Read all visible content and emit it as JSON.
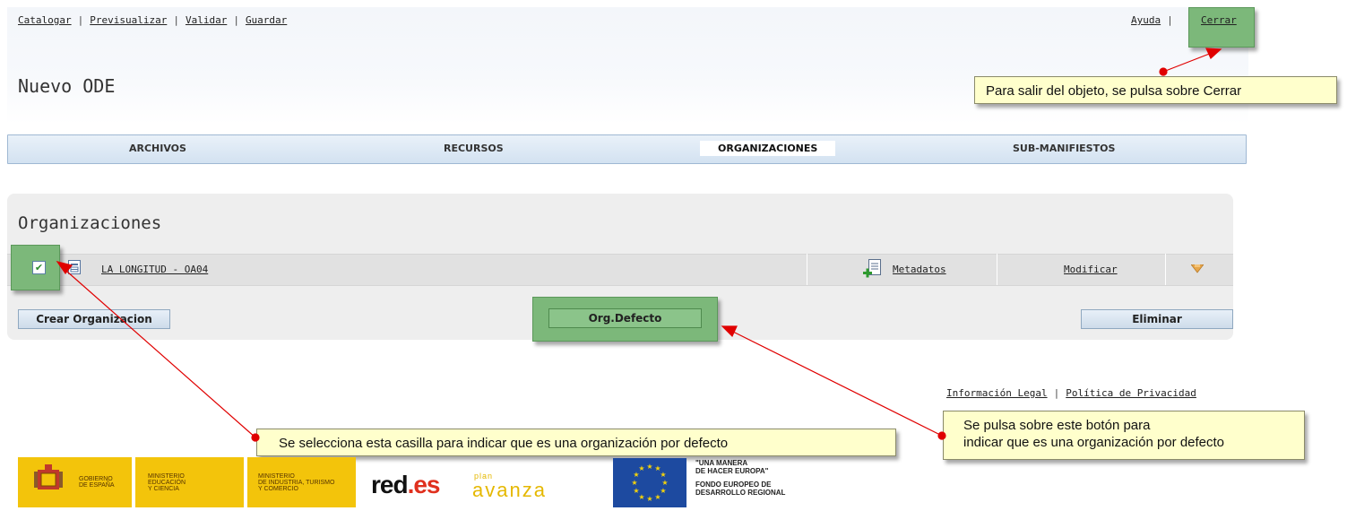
{
  "top_nav": {
    "catalogar": "Catalogar",
    "previsualizar": "Previsualizar",
    "validar": "Validar",
    "guardar": "Guardar",
    "separator": "|"
  },
  "top_right_nav": {
    "ayuda": "Ayuda",
    "cerrar": "Cerrar",
    "separator": "|"
  },
  "page_title": "Nuevo ODE",
  "tabs": [
    {
      "label": "ARCHIVOS",
      "active": false
    },
    {
      "label": "RECURSOS",
      "active": false
    },
    {
      "label": "ORGANIZACIONES",
      "active": true
    },
    {
      "label": "SUB-MANIFIESTOS",
      "active": false
    }
  ],
  "organizations": {
    "heading": "Organizaciones",
    "rows": [
      {
        "checked": true,
        "name": "LA LONGITUD - OA04",
        "metadata_label": "Metadatos",
        "modify_label": "Modificar"
      }
    ],
    "buttons": {
      "create": "Crear Organizacion",
      "default": "Org.Defecto",
      "delete": "Eliminar"
    }
  },
  "footer": {
    "legal": "Información Legal",
    "privacy": "Política de Privacidad",
    "separator": "|"
  },
  "callouts": {
    "close": "Para salir del objeto, se pulsa sobre Cerrar",
    "checkbox": "Se selecciona esta casilla para indicar que es una organización por defecto",
    "default_line1": "Se pulsa sobre este botón para",
    "default_line2": "indicar que es una organización por defecto"
  },
  "logos": {
    "gobierno": "GOBIERNO DE ESPAÑA",
    "gobierno_line1": "GOBIERNO",
    "gobierno_line2": "DE ESPAÑA",
    "ministerio_educacion_line1": "MINISTERIO",
    "ministerio_educacion_line2": "EDUCACIÓN",
    "ministerio_educacion_line3": "Y CIENCIA",
    "ministerio_industria_line1": "MINISTERIO",
    "ministerio_industria_line2": "DE INDUSTRIA, TURISMO",
    "ministerio_industria_line3": "Y COMERCIO",
    "rede_main": "red",
    "rede_suffix": ".es",
    "plan_avanza_small": "plan",
    "plan_avanza_big": "avanza",
    "eu_line1": "\"UNA MANERA",
    "eu_line2": "DE HACER EUROPA\"",
    "eu_line3": "FONDO EUROPEO DE",
    "eu_line4": "DESARROLLO REGIONAL"
  },
  "colors": {
    "highlight_green": "#7cb87a",
    "callout_yellow": "#ffffcc",
    "arrow_red": "#e00000",
    "tab_bar_blue": "#d3e2f1",
    "logo_yellow": "#f3c40b",
    "eu_blue": "#1d4aa0"
  }
}
